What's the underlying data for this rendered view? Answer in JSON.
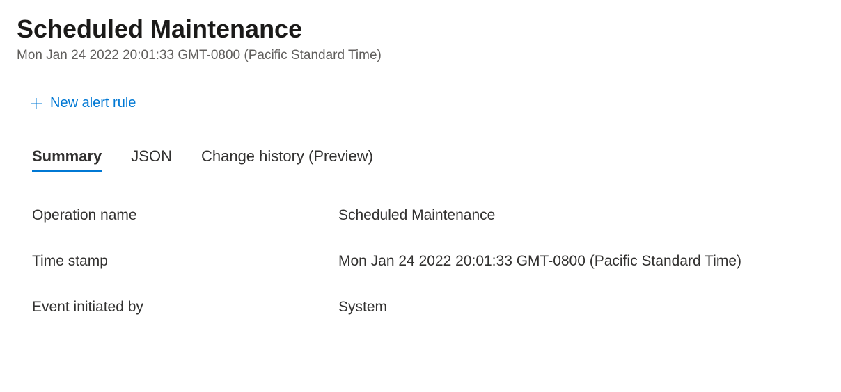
{
  "header": {
    "title": "Scheduled Maintenance",
    "subtitle": "Mon Jan 24 2022 20:01:33 GMT-0800 (Pacific Standard Time)"
  },
  "toolbar": {
    "new_alert_label": "New alert rule"
  },
  "tabs": {
    "summary": "Summary",
    "json": "JSON",
    "change_history": "Change history (Preview)"
  },
  "details": {
    "operation_name": {
      "label": "Operation name",
      "value": "Scheduled Maintenance"
    },
    "time_stamp": {
      "label": "Time stamp",
      "value": "Mon Jan 24 2022 20:01:33 GMT-0800 (Pacific Standard Time)"
    },
    "event_initiated_by": {
      "label": "Event initiated by",
      "value": "System"
    }
  }
}
